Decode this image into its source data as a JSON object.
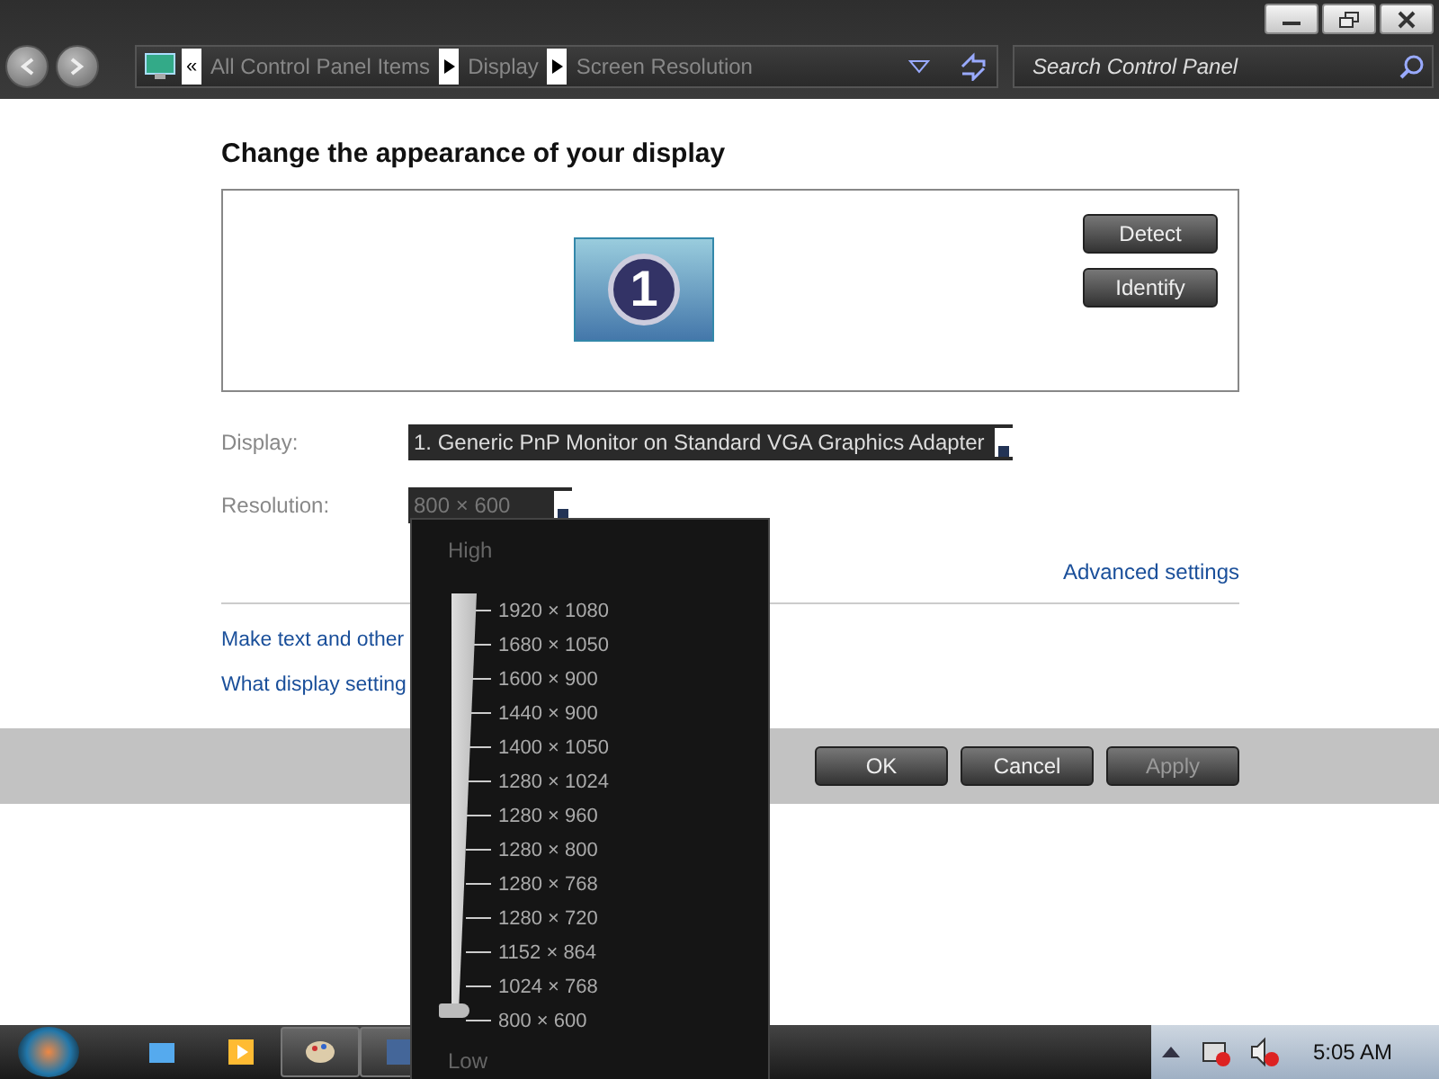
{
  "address_bar": {
    "overflow": "«",
    "crumbs": [
      "All Control Panel Items",
      "Display",
      "Screen Resolution"
    ]
  },
  "search": {
    "placeholder": "Search Control Panel"
  },
  "heading": "Change the appearance of your display",
  "monitor": {
    "number": "1",
    "selected": true
  },
  "monitor_buttons": [
    "Detect",
    "Identify"
  ],
  "display": {
    "label": "Display:",
    "value": "1. Generic PnP Monitor on Standard VGA Graphics Adapter"
  },
  "resolution": {
    "label": "Resolution:",
    "value": "800 × 600",
    "expanded": true
  },
  "advanced_link": "Advanced settings",
  "links": [
    "Make text and other",
    "What display setting"
  ],
  "buttons": [
    {
      "label": "OK",
      "disabled": false
    },
    {
      "label": "Cancel",
      "disabled": false
    },
    {
      "label": "Apply",
      "disabled": true
    }
  ],
  "resolution_popup": {
    "high": "High",
    "low": "Low",
    "level": 0,
    "options": [
      "1920 × 1080",
      "1680 × 1050",
      "1600 × 900",
      "1440 × 900",
      "1400 × 1050",
      "1280 × 1024",
      "1280 × 960",
      "1280 × 800",
      "1280 × 768",
      "1280 × 720",
      "1152 × 864",
      "1024 × 768",
      "800 × 600"
    ]
  },
  "taskbar": {
    "clock": "5:05 AM"
  }
}
